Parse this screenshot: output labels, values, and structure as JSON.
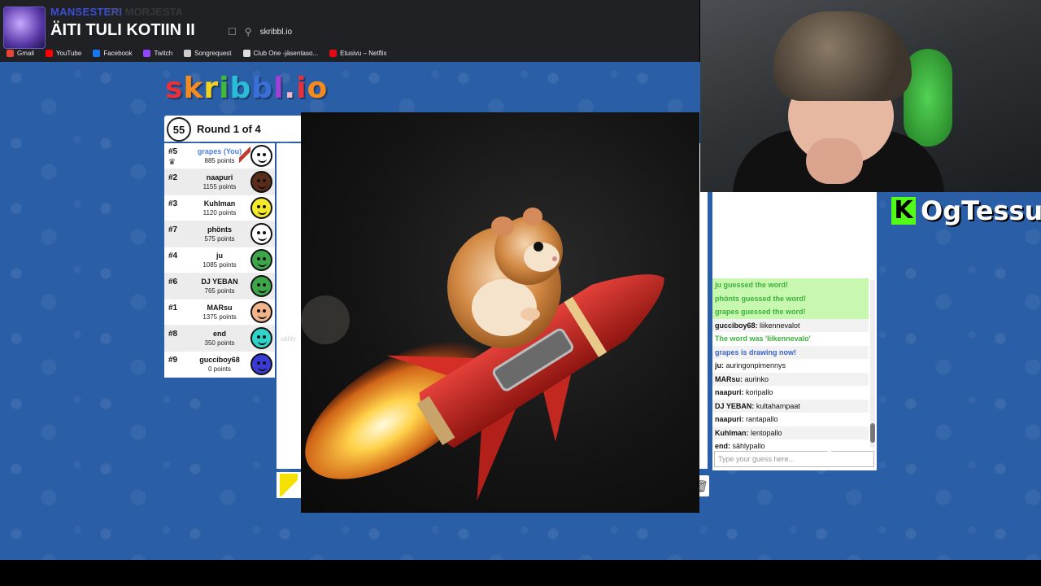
{
  "browser": {
    "url": "skribbl.io",
    "bookmarks": [
      {
        "label": "Gmail",
        "color": "#ea4335"
      },
      {
        "label": "YouTube",
        "color": "#ff0000"
      },
      {
        "label": "Facebook",
        "color": "#1877f2"
      },
      {
        "label": "Twitch",
        "color": "#9146ff"
      },
      {
        "label": "Songrequest",
        "color": "#cccccc"
      },
      {
        "label": "Club One -jäsentaso...",
        "color": "#dddddd"
      },
      {
        "label": "Etusivu – Netflix",
        "color": "#e50914"
      }
    ]
  },
  "overlay": {
    "subtitle": "MANSESTERI",
    "subtitle_ghost": "DE MORJESTA",
    "title": "ÄITI TULI KOTIIN II"
  },
  "logo": {
    "letters": [
      "s",
      "k",
      "r",
      "i",
      "b",
      "b",
      "l",
      ".",
      "i",
      "o"
    ],
    "colors": [
      "#e8303a",
      "#f58a1f",
      "#f4d21b",
      "#40b938",
      "#2bbcd8",
      "#3a6fd8",
      "#a23fd6",
      "#f7b3c8",
      "#e8303a",
      "#f58a1f"
    ]
  },
  "round": {
    "timer": "55",
    "label": "Round 1 of 4"
  },
  "players": [
    {
      "rank": "#5",
      "name": "grapes (You)",
      "points": "885 points",
      "avatar": "#ffffff",
      "self": true
    },
    {
      "rank": "#2",
      "name": "naapuri",
      "points": "1155 points",
      "avatar": "#5a2d1a"
    },
    {
      "rank": "#3",
      "name": "Kuhlman",
      "points": "1120 points",
      "avatar": "#f2ea2a"
    },
    {
      "rank": "#7",
      "name": "phönts",
      "points": "575 points",
      "avatar": "#ffffff"
    },
    {
      "rank": "#4",
      "name": "ju",
      "points": "1085 points",
      "avatar": "#3ea64a"
    },
    {
      "rank": "#6",
      "name": "DJ YEBAN",
      "points": "765 points",
      "avatar": "#3ea64a"
    },
    {
      "rank": "#1",
      "name": "MARsu",
      "points": "1375 points",
      "avatar": "#f2b48a"
    },
    {
      "rank": "#8",
      "name": "end",
      "points": "350 points",
      "avatar": "#2fd3c7"
    },
    {
      "rank": "#9",
      "name": "gucciboy68",
      "points": "0 points",
      "avatar": "#3a3ad6"
    }
  ],
  "canvas": {
    "ghost_word": "sähly"
  },
  "streamer": {
    "kick_letter": "K",
    "name": "OgTessu"
  },
  "chat": {
    "messages": [
      {
        "type": "guess",
        "author": "",
        "text": "ju guessed the word!"
      },
      {
        "type": "guess",
        "author": "",
        "text": "phönts guessed the word!"
      },
      {
        "type": "guess",
        "author": "",
        "text": "grapes guessed the word!"
      },
      {
        "type": "msg",
        "author": "gucciboy68:",
        "text": " liikennevalot"
      },
      {
        "type": "word",
        "author": "",
        "text": "The word was 'liikennevalo'"
      },
      {
        "type": "drawing",
        "author": "",
        "text": "grapes is drawing now!"
      },
      {
        "type": "msg",
        "author": "ju:",
        "text": " auringonpimennys"
      },
      {
        "type": "msg",
        "author": "MARsu:",
        "text": " aurinko"
      },
      {
        "type": "msg",
        "author": "naapuri:",
        "text": " koripallo"
      },
      {
        "type": "msg",
        "author": "DJ YEBAN:",
        "text": " kultahampaat"
      },
      {
        "type": "msg",
        "author": "naapuri:",
        "text": " rantapallo"
      },
      {
        "type": "msg",
        "author": "Kuhlman:",
        "text": " lentopallo"
      },
      {
        "type": "msg",
        "author": "end:",
        "text": " sählypallo"
      }
    ],
    "input_placeholder": "Type your guess here..."
  }
}
